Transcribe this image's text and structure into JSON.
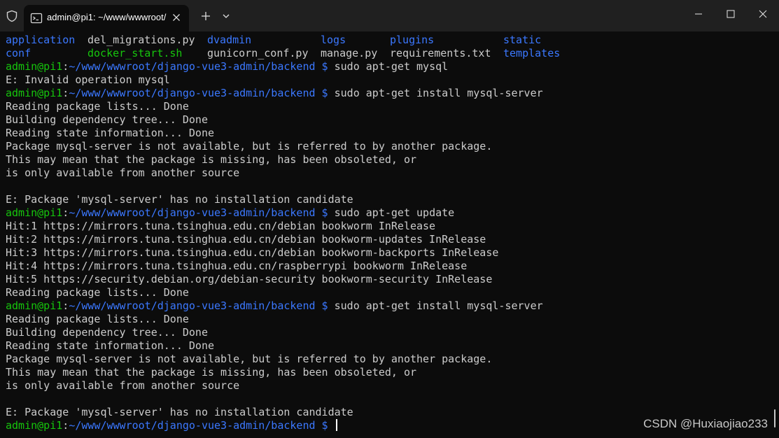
{
  "tab": {
    "title": "admin@pi1: ~/www/wwwroot/"
  },
  "icons": {
    "shield": "shield-icon",
    "terminal": "terminal-icon",
    "close_tab": "close-icon",
    "new_tab": "plus-icon",
    "dropdown": "chevron-down-icon",
    "minimize": "minimize-icon",
    "maximize": "maximize-icon",
    "close_window": "close-icon"
  },
  "colors": {
    "background": "#0c0c0c",
    "titlebar": "#202020",
    "text": "#cccccc",
    "prompt_user": "#16c60c",
    "prompt_path": "#3b78ff",
    "directory": "#3b78ff",
    "executable": "#16c60c"
  },
  "ls_output": {
    "row1": [
      "application",
      "del_migrations.py",
      "dvadmin",
      "logs",
      "plugins",
      "static"
    ],
    "row2": [
      "conf",
      "docker_start.sh",
      "gunicorn_conf.py",
      "manage.py",
      "requirements.txt",
      "templates"
    ]
  },
  "prompt": {
    "user": "admin@pi1",
    "colon": ":",
    "path": "~/www/wwwroot/django-vue3-admin/backend",
    "dollar": "$"
  },
  "lines": [
    {
      "type": "prompt",
      "cmd": "sudo apt-get mysql"
    },
    {
      "type": "out",
      "text": "E: Invalid operation mysql"
    },
    {
      "type": "prompt",
      "cmd": "sudo apt-get install mysql-server"
    },
    {
      "type": "out",
      "text": "Reading package lists... Done"
    },
    {
      "type": "out",
      "text": "Building dependency tree... Done"
    },
    {
      "type": "out",
      "text": "Reading state information... Done"
    },
    {
      "type": "out",
      "text": "Package mysql-server is not available, but is referred to by another package."
    },
    {
      "type": "out",
      "text": "This may mean that the package is missing, has been obsoleted, or"
    },
    {
      "type": "out",
      "text": "is only available from another source"
    },
    {
      "type": "out",
      "text": ""
    },
    {
      "type": "out",
      "text": "E: Package 'mysql-server' has no installation candidate"
    },
    {
      "type": "prompt",
      "cmd": "sudo apt-get update"
    },
    {
      "type": "out",
      "text": "Hit:1 https://mirrors.tuna.tsinghua.edu.cn/debian bookworm InRelease"
    },
    {
      "type": "out",
      "text": "Hit:2 https://mirrors.tuna.tsinghua.edu.cn/debian bookworm-updates InRelease"
    },
    {
      "type": "out",
      "text": "Hit:3 https://mirrors.tuna.tsinghua.edu.cn/debian bookworm-backports InRelease"
    },
    {
      "type": "out",
      "text": "Hit:4 https://mirrors.tuna.tsinghua.edu.cn/raspberrypi bookworm InRelease"
    },
    {
      "type": "out",
      "text": "Hit:5 https://security.debian.org/debian-security bookworm-security InRelease"
    },
    {
      "type": "out",
      "text": "Reading package lists... Done"
    },
    {
      "type": "prompt",
      "cmd": "sudo apt-get install mysql-server"
    },
    {
      "type": "out",
      "text": "Reading package lists... Done"
    },
    {
      "type": "out",
      "text": "Building dependency tree... Done"
    },
    {
      "type": "out",
      "text": "Reading state information... Done"
    },
    {
      "type": "out",
      "text": "Package mysql-server is not available, but is referred to by another package."
    },
    {
      "type": "out",
      "text": "This may mean that the package is missing, has been obsoleted, or"
    },
    {
      "type": "out",
      "text": "is only available from another source"
    },
    {
      "type": "out",
      "text": ""
    },
    {
      "type": "out",
      "text": "E: Package 'mysql-server' has no installation candidate"
    },
    {
      "type": "prompt",
      "cmd": "",
      "cursor": true
    }
  ],
  "watermark": "CSDN @Huxiaojiao233"
}
